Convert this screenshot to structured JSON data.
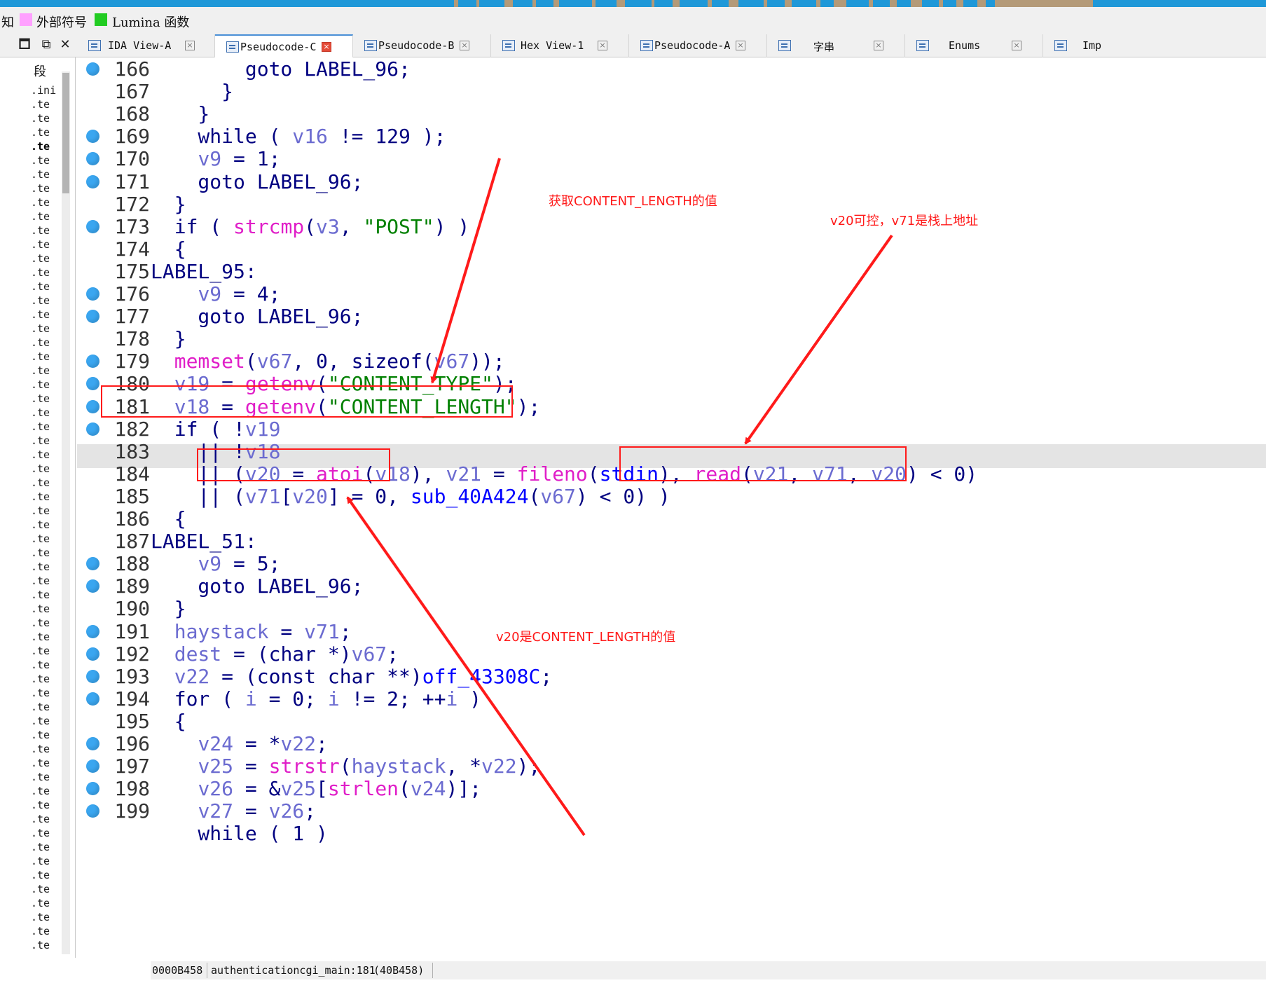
{
  "legend": [
    {
      "label": "知",
      "color": ""
    },
    {
      "label": "外部符号",
      "color": "#ffa0ff"
    },
    {
      "label": "Lumina 函数",
      "color": "#22cc22"
    }
  ],
  "tabs": [
    {
      "label": "IDA View-A",
      "icon": "ida-view-icon",
      "active": false
    },
    {
      "label": "Pseudocode-C",
      "icon": "pseudocode-icon",
      "active": true
    },
    {
      "label": "Pseudocode-B",
      "icon": "pseudocode-icon",
      "active": false
    },
    {
      "label": "Hex View-1",
      "icon": "hex-view-icon",
      "active": false
    },
    {
      "label": "Pseudocode-A",
      "icon": "pseudocode-icon",
      "active": false
    },
    {
      "label": "字串",
      "icon": "strings-icon",
      "active": false
    },
    {
      "label": "Enums",
      "icon": "enums-icon",
      "active": false
    },
    {
      "label": "Imp",
      "icon": "imports-icon",
      "active": false
    }
  ],
  "tab_close_glyph": "×",
  "segments": {
    "header": "段",
    "items": [
      ".ini",
      ".te",
      ".te",
      ".te",
      ".te",
      ".te",
      ".te",
      ".te",
      ".te",
      ".te",
      ".te",
      ".te",
      ".te",
      ".te",
      ".te",
      ".te",
      ".te",
      ".te",
      ".te",
      ".te",
      ".te",
      ".te",
      ".te",
      ".te",
      ".te",
      ".te",
      ".te",
      ".te",
      ".te",
      ".te",
      ".te",
      ".te",
      ".te",
      ".te",
      ".te",
      ".te",
      ".te",
      ".te",
      ".te",
      ".te",
      ".te",
      ".te",
      ".te",
      ".te",
      ".te",
      ".te",
      ".te",
      ".te",
      ".te",
      ".te",
      ".te",
      ".te",
      ".te",
      ".te",
      ".te",
      ".te",
      ".te",
      ".te",
      ".te",
      ".te",
      ".te",
      ".te"
    ],
    "current_index": 4
  },
  "code": {
    "highlighted_line": 181,
    "lines": [
      {
        "n": "166",
        "bp": true,
        "tokens": [
          [
            "",
            "        goto LABEL_96;"
          ]
        ]
      },
      {
        "n": "167",
        "bp": false,
        "tokens": [
          [
            "",
            "      }"
          ]
        ]
      },
      {
        "n": "168",
        "bp": false,
        "tokens": [
          [
            "",
            "    }"
          ]
        ]
      },
      {
        "n": "169",
        "bp": true,
        "tokens": [
          [
            "",
            "    while ( "
          ],
          [
            "var",
            "v16"
          ],
          [
            "",
            " != 129 );"
          ]
        ]
      },
      {
        "n": "170",
        "bp": true,
        "tokens": [
          [
            "",
            "    "
          ],
          [
            "var",
            "v9"
          ],
          [
            "",
            " = 1;"
          ]
        ]
      },
      {
        "n": "171",
        "bp": true,
        "tokens": [
          [
            "",
            "    goto LABEL_96;"
          ]
        ]
      },
      {
        "n": "172",
        "bp": false,
        "tokens": [
          [
            "",
            "  }"
          ]
        ]
      },
      {
        "n": "173",
        "bp": true,
        "tokens": [
          [
            "",
            "  if ( "
          ],
          [
            "fn",
            "strcmp"
          ],
          [
            "",
            "("
          ],
          [
            "var",
            "v3"
          ],
          [
            "",
            ", "
          ],
          [
            "str",
            "\"POST\""
          ],
          [
            "",
            ") )"
          ]
        ]
      },
      {
        "n": "174",
        "bp": false,
        "tokens": [
          [
            "",
            "  {"
          ]
        ]
      },
      {
        "n": "175",
        "bp": false,
        "tokens": [
          [
            "",
            "LABEL_95:"
          ]
        ]
      },
      {
        "n": "176",
        "bp": true,
        "tokens": [
          [
            "",
            "    "
          ],
          [
            "var",
            "v9"
          ],
          [
            "",
            " = 4;"
          ]
        ]
      },
      {
        "n": "177",
        "bp": true,
        "tokens": [
          [
            "",
            "    goto LABEL_96;"
          ]
        ]
      },
      {
        "n": "178",
        "bp": false,
        "tokens": [
          [
            "",
            "  }"
          ]
        ]
      },
      {
        "n": "179",
        "bp": true,
        "tokens": [
          [
            "",
            "  "
          ],
          [
            "fn",
            "memset"
          ],
          [
            "",
            "("
          ],
          [
            "var",
            "v67"
          ],
          [
            "",
            ", 0, sizeof("
          ],
          [
            "var",
            "v67"
          ],
          [
            "",
            "));"
          ]
        ]
      },
      {
        "n": "180",
        "bp": true,
        "tokens": [
          [
            "",
            "  "
          ],
          [
            "var",
            "v19"
          ],
          [
            "",
            " = "
          ],
          [
            "fn",
            "getenv"
          ],
          [
            "",
            "("
          ],
          [
            "str",
            "\"CONTENT_TYPE\""
          ],
          [
            "",
            ");"
          ]
        ]
      },
      {
        "n": "181",
        "bp": true,
        "tokens": [
          [
            "",
            "  "
          ],
          [
            "var",
            "v18"
          ],
          [
            "",
            " = "
          ],
          [
            "fn",
            "getenv"
          ],
          [
            "",
            "("
          ],
          [
            "str",
            "\"CONTENT_LENGTH\""
          ],
          [
            "",
            ");"
          ]
        ]
      },
      {
        "n": "182",
        "bp": true,
        "tokens": [
          [
            "",
            "  if ( !"
          ],
          [
            "var",
            "v19"
          ]
        ]
      },
      {
        "n": "183",
        "bp": false,
        "tokens": [
          [
            "",
            "    || !"
          ],
          [
            "var",
            "v18"
          ]
        ]
      },
      {
        "n": "184",
        "bp": false,
        "tokens": [
          [
            "",
            "    || ("
          ],
          [
            "var",
            "v20"
          ],
          [
            "",
            " = "
          ],
          [
            "fn",
            "atoi"
          ],
          [
            "",
            "("
          ],
          [
            "var",
            "v18"
          ],
          [
            "",
            "), "
          ],
          [
            "var",
            "v21"
          ],
          [
            "",
            " = "
          ],
          [
            "fn",
            "fileno"
          ],
          [
            "",
            "("
          ],
          [
            "id",
            "stdin"
          ],
          [
            "",
            "), "
          ],
          [
            "fn",
            "read"
          ],
          [
            "",
            "("
          ],
          [
            "var",
            "v21"
          ],
          [
            "",
            ", "
          ],
          [
            "var",
            "v71"
          ],
          [
            "",
            ", "
          ],
          [
            "var",
            "v20"
          ],
          [
            "",
            ") < 0)"
          ]
        ]
      },
      {
        "n": "185",
        "bp": false,
        "tokens": [
          [
            "",
            "    || ("
          ],
          [
            "var",
            "v71"
          ],
          [
            "",
            "["
          ],
          [
            "var",
            "v20"
          ],
          [
            "",
            "] = 0, "
          ],
          [
            "id",
            "sub_40A424"
          ],
          [
            "",
            "("
          ],
          [
            "var",
            "v67"
          ],
          [
            "",
            ") < 0) )"
          ]
        ]
      },
      {
        "n": "186",
        "bp": false,
        "tokens": [
          [
            "",
            "  {"
          ]
        ]
      },
      {
        "n": "187",
        "bp": false,
        "tokens": [
          [
            "",
            "LABEL_51:"
          ]
        ]
      },
      {
        "n": "188",
        "bp": true,
        "tokens": [
          [
            "",
            "    "
          ],
          [
            "var",
            "v9"
          ],
          [
            "",
            " = 5;"
          ]
        ]
      },
      {
        "n": "189",
        "bp": true,
        "tokens": [
          [
            "",
            "    goto LABEL_96;"
          ]
        ]
      },
      {
        "n": "190",
        "bp": false,
        "tokens": [
          [
            "",
            "  }"
          ]
        ]
      },
      {
        "n": "191",
        "bp": true,
        "tokens": [
          [
            "",
            "  "
          ],
          [
            "var",
            "haystack"
          ],
          [
            "",
            " = "
          ],
          [
            "var",
            "v71"
          ],
          [
            "",
            ";"
          ]
        ]
      },
      {
        "n": "192",
        "bp": true,
        "tokens": [
          [
            "",
            "  "
          ],
          [
            "var",
            "dest"
          ],
          [
            "",
            " = (char *)"
          ],
          [
            "var",
            "v67"
          ],
          [
            "",
            ";"
          ]
        ]
      },
      {
        "n": "193",
        "bp": true,
        "tokens": [
          [
            "",
            "  "
          ],
          [
            "var",
            "v22"
          ],
          [
            "",
            " = (const char **)"
          ],
          [
            "id",
            "off_43308C"
          ],
          [
            "",
            ";"
          ]
        ]
      },
      {
        "n": "194",
        "bp": true,
        "tokens": [
          [
            "",
            "  for ( "
          ],
          [
            "var",
            "i"
          ],
          [
            "",
            " = 0; "
          ],
          [
            "var",
            "i"
          ],
          [
            "",
            " != 2; ++"
          ],
          [
            "var",
            "i"
          ],
          [
            "",
            " )"
          ]
        ]
      },
      {
        "n": "195",
        "bp": false,
        "tokens": [
          [
            "",
            "  {"
          ]
        ]
      },
      {
        "n": "196",
        "bp": true,
        "tokens": [
          [
            "",
            "    "
          ],
          [
            "var",
            "v24"
          ],
          [
            "",
            " = *"
          ],
          [
            "var",
            "v22"
          ],
          [
            "",
            ";"
          ]
        ]
      },
      {
        "n": "197",
        "bp": true,
        "tokens": [
          [
            "",
            "    "
          ],
          [
            "var",
            "v25"
          ],
          [
            "",
            " = "
          ],
          [
            "fn",
            "strstr"
          ],
          [
            "",
            "("
          ],
          [
            "var",
            "haystack"
          ],
          [
            "",
            ", *"
          ],
          [
            "var",
            "v22"
          ],
          [
            "",
            ");"
          ]
        ]
      },
      {
        "n": "198",
        "bp": true,
        "tokens": [
          [
            "",
            "    "
          ],
          [
            "var",
            "v26"
          ],
          [
            "",
            " = &"
          ],
          [
            "var",
            "v25"
          ],
          [
            "",
            "["
          ],
          [
            "fn",
            "strlen"
          ],
          [
            "",
            "("
          ],
          [
            "var",
            "v24"
          ],
          [
            "",
            ")];"
          ]
        ]
      },
      {
        "n": "199",
        "bp": true,
        "tokens": [
          [
            "",
            "    "
          ],
          [
            "var",
            "v27"
          ],
          [
            "",
            " = "
          ],
          [
            "var",
            "v26"
          ],
          [
            "",
            ";"
          ]
        ]
      },
      {
        "n": "",
        "bp": false,
        "tokens": [
          [
            "",
            "    while ( 1 )"
          ]
        ]
      }
    ]
  },
  "annotations": [
    {
      "text": "获取CONTENT_LENGTH的值"
    },
    {
      "text": "v20可控，v71是栈上地址"
    },
    {
      "text": "v20是CONTENT_LENGTH的值"
    }
  ],
  "annotation_color": "#ff1a1a",
  "status": {
    "address": "0000B458",
    "location": "authenticationcgi_main:181",
    "ea": "(40B458)"
  },
  "colors": {
    "keyword": "#000080",
    "variable": "#6b6bd0",
    "function": "#e01ec8",
    "string": "#008000",
    "identifier": "#0000ff",
    "breakpoint": "#3aa6f0"
  }
}
